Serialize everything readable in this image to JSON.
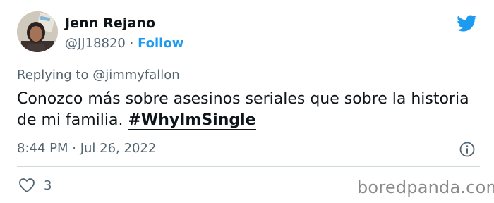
{
  "author": {
    "name": "Jenn Rejano",
    "handle": "@JJ18820",
    "separator": " · ",
    "follow_label": "Follow"
  },
  "reply": {
    "prefix": "Replying to ",
    "target": "@jimmyfallon"
  },
  "tweet": {
    "text": "Conozco más sobre asesinos seriales que sobre la historia de mi familia. ",
    "hashtag": "#WhyImSingle"
  },
  "meta": {
    "time": "8:44 PM",
    "separator": " · ",
    "date": "Jul 26, 2022"
  },
  "stats": {
    "likes": "3"
  },
  "watermark": "boredpanda.com",
  "icons": {
    "brand": "twitter-bird-icon",
    "info": "info-icon",
    "like": "heart-icon"
  },
  "colors": {
    "accent": "#1d9bf0",
    "text": "#0f1419",
    "secondary": "#536471",
    "divider": "#cfd9de"
  }
}
